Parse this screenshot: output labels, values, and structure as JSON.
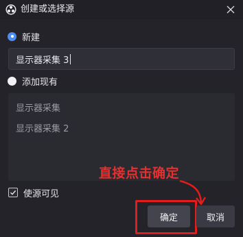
{
  "window": {
    "title": "创建或选择源",
    "app_icon": "obs-logo-icon",
    "close_icon": "close-icon"
  },
  "options": {
    "new_label": "新建",
    "new_selected": true,
    "existing_label": "添加现有",
    "existing_selected": false
  },
  "name_input": {
    "value": "显示器采集 3"
  },
  "existing_list": {
    "items": [
      "显示器采集",
      "显示器采集 2"
    ]
  },
  "visibility": {
    "label": "使源可见",
    "checked": true
  },
  "annotation": {
    "text": "直接点击确定",
    "color": "#e53030"
  },
  "buttons": {
    "ok_label": "确定",
    "cancel_label": "取消"
  },
  "colors": {
    "accent": "#4e8df0",
    "highlight": "#e11d1d",
    "background": "#232329"
  }
}
